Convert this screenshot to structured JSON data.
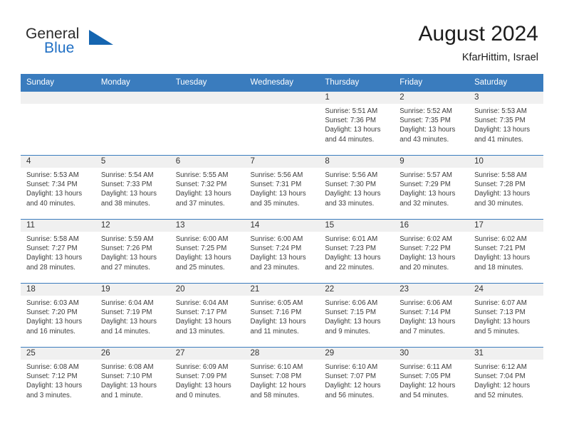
{
  "brand": {
    "name_part1": "General",
    "name_part2": "Blue",
    "accent_color": "#1565b0"
  },
  "header": {
    "title": "August 2024",
    "location": "KfarHittim, Israel"
  },
  "calendar": {
    "header_bg": "#3a7cbe",
    "weekday_headers": [
      "Sunday",
      "Monday",
      "Tuesday",
      "Wednesday",
      "Thursday",
      "Friday",
      "Saturday"
    ],
    "weeks": [
      [
        {
          "day": "",
          "lines": []
        },
        {
          "day": "",
          "lines": []
        },
        {
          "day": "",
          "lines": []
        },
        {
          "day": "",
          "lines": []
        },
        {
          "day": "1",
          "lines": [
            "Sunrise: 5:51 AM",
            "Sunset: 7:36 PM",
            "Daylight: 13 hours",
            "and 44 minutes."
          ]
        },
        {
          "day": "2",
          "lines": [
            "Sunrise: 5:52 AM",
            "Sunset: 7:35 PM",
            "Daylight: 13 hours",
            "and 43 minutes."
          ]
        },
        {
          "day": "3",
          "lines": [
            "Sunrise: 5:53 AM",
            "Sunset: 7:35 PM",
            "Daylight: 13 hours",
            "and 41 minutes."
          ]
        }
      ],
      [
        {
          "day": "4",
          "lines": [
            "Sunrise: 5:53 AM",
            "Sunset: 7:34 PM",
            "Daylight: 13 hours",
            "and 40 minutes."
          ]
        },
        {
          "day": "5",
          "lines": [
            "Sunrise: 5:54 AM",
            "Sunset: 7:33 PM",
            "Daylight: 13 hours",
            "and 38 minutes."
          ]
        },
        {
          "day": "6",
          "lines": [
            "Sunrise: 5:55 AM",
            "Sunset: 7:32 PM",
            "Daylight: 13 hours",
            "and 37 minutes."
          ]
        },
        {
          "day": "7",
          "lines": [
            "Sunrise: 5:56 AM",
            "Sunset: 7:31 PM",
            "Daylight: 13 hours",
            "and 35 minutes."
          ]
        },
        {
          "day": "8",
          "lines": [
            "Sunrise: 5:56 AM",
            "Sunset: 7:30 PM",
            "Daylight: 13 hours",
            "and 33 minutes."
          ]
        },
        {
          "day": "9",
          "lines": [
            "Sunrise: 5:57 AM",
            "Sunset: 7:29 PM",
            "Daylight: 13 hours",
            "and 32 minutes."
          ]
        },
        {
          "day": "10",
          "lines": [
            "Sunrise: 5:58 AM",
            "Sunset: 7:28 PM",
            "Daylight: 13 hours",
            "and 30 minutes."
          ]
        }
      ],
      [
        {
          "day": "11",
          "lines": [
            "Sunrise: 5:58 AM",
            "Sunset: 7:27 PM",
            "Daylight: 13 hours",
            "and 28 minutes."
          ]
        },
        {
          "day": "12",
          "lines": [
            "Sunrise: 5:59 AM",
            "Sunset: 7:26 PM",
            "Daylight: 13 hours",
            "and 27 minutes."
          ]
        },
        {
          "day": "13",
          "lines": [
            "Sunrise: 6:00 AM",
            "Sunset: 7:25 PM",
            "Daylight: 13 hours",
            "and 25 minutes."
          ]
        },
        {
          "day": "14",
          "lines": [
            "Sunrise: 6:00 AM",
            "Sunset: 7:24 PM",
            "Daylight: 13 hours",
            "and 23 minutes."
          ]
        },
        {
          "day": "15",
          "lines": [
            "Sunrise: 6:01 AM",
            "Sunset: 7:23 PM",
            "Daylight: 13 hours",
            "and 22 minutes."
          ]
        },
        {
          "day": "16",
          "lines": [
            "Sunrise: 6:02 AM",
            "Sunset: 7:22 PM",
            "Daylight: 13 hours",
            "and 20 minutes."
          ]
        },
        {
          "day": "17",
          "lines": [
            "Sunrise: 6:02 AM",
            "Sunset: 7:21 PM",
            "Daylight: 13 hours",
            "and 18 minutes."
          ]
        }
      ],
      [
        {
          "day": "18",
          "lines": [
            "Sunrise: 6:03 AM",
            "Sunset: 7:20 PM",
            "Daylight: 13 hours",
            "and 16 minutes."
          ]
        },
        {
          "day": "19",
          "lines": [
            "Sunrise: 6:04 AM",
            "Sunset: 7:19 PM",
            "Daylight: 13 hours",
            "and 14 minutes."
          ]
        },
        {
          "day": "20",
          "lines": [
            "Sunrise: 6:04 AM",
            "Sunset: 7:17 PM",
            "Daylight: 13 hours",
            "and 13 minutes."
          ]
        },
        {
          "day": "21",
          "lines": [
            "Sunrise: 6:05 AM",
            "Sunset: 7:16 PM",
            "Daylight: 13 hours",
            "and 11 minutes."
          ]
        },
        {
          "day": "22",
          "lines": [
            "Sunrise: 6:06 AM",
            "Sunset: 7:15 PM",
            "Daylight: 13 hours",
            "and 9 minutes."
          ]
        },
        {
          "day": "23",
          "lines": [
            "Sunrise: 6:06 AM",
            "Sunset: 7:14 PM",
            "Daylight: 13 hours",
            "and 7 minutes."
          ]
        },
        {
          "day": "24",
          "lines": [
            "Sunrise: 6:07 AM",
            "Sunset: 7:13 PM",
            "Daylight: 13 hours",
            "and 5 minutes."
          ]
        }
      ],
      [
        {
          "day": "25",
          "lines": [
            "Sunrise: 6:08 AM",
            "Sunset: 7:12 PM",
            "Daylight: 13 hours",
            "and 3 minutes."
          ]
        },
        {
          "day": "26",
          "lines": [
            "Sunrise: 6:08 AM",
            "Sunset: 7:10 PM",
            "Daylight: 13 hours",
            "and 1 minute."
          ]
        },
        {
          "day": "27",
          "lines": [
            "Sunrise: 6:09 AM",
            "Sunset: 7:09 PM",
            "Daylight: 13 hours",
            "and 0 minutes."
          ]
        },
        {
          "day": "28",
          "lines": [
            "Sunrise: 6:10 AM",
            "Sunset: 7:08 PM",
            "Daylight: 12 hours",
            "and 58 minutes."
          ]
        },
        {
          "day": "29",
          "lines": [
            "Sunrise: 6:10 AM",
            "Sunset: 7:07 PM",
            "Daylight: 12 hours",
            "and 56 minutes."
          ]
        },
        {
          "day": "30",
          "lines": [
            "Sunrise: 6:11 AM",
            "Sunset: 7:05 PM",
            "Daylight: 12 hours",
            "and 54 minutes."
          ]
        },
        {
          "day": "31",
          "lines": [
            "Sunrise: 6:12 AM",
            "Sunset: 7:04 PM",
            "Daylight: 12 hours",
            "and 52 minutes."
          ]
        }
      ]
    ]
  }
}
